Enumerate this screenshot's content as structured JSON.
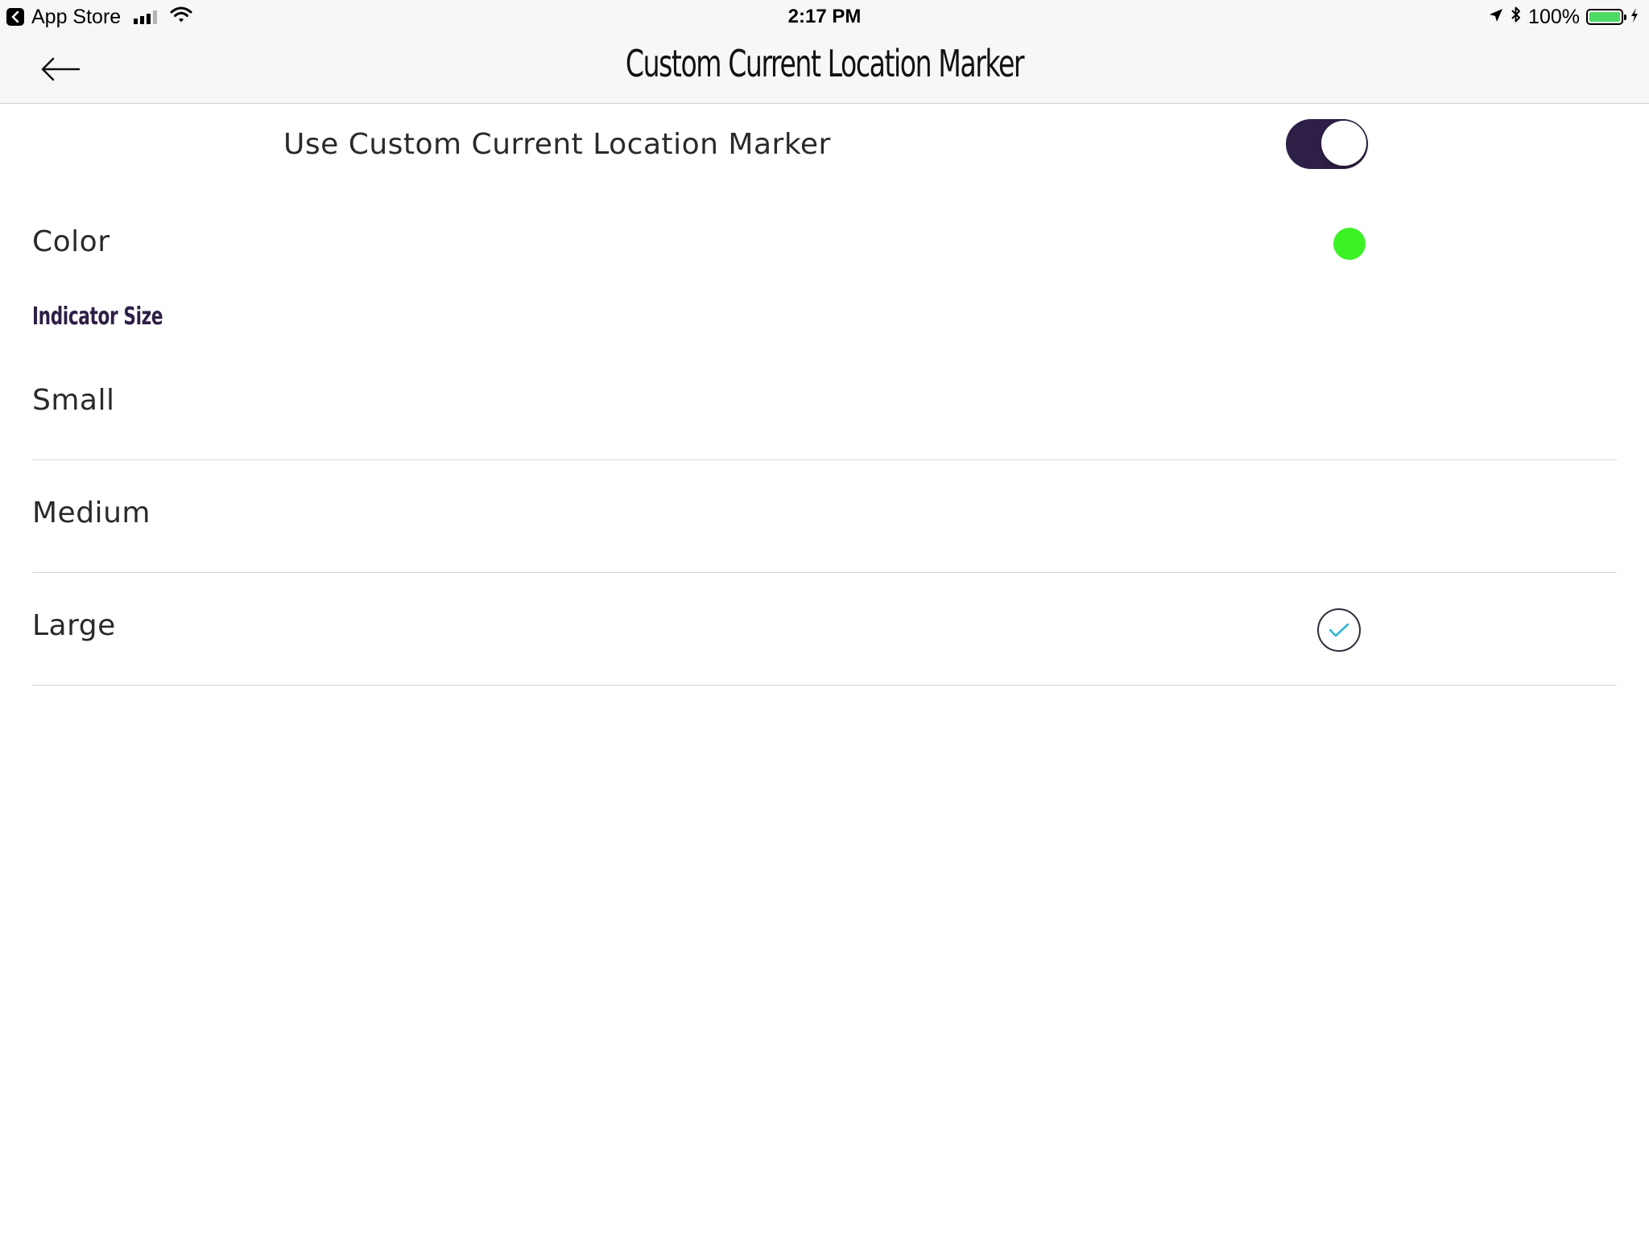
{
  "status_bar": {
    "back_app": "App Store",
    "time": "2:17 PM",
    "battery_percent": "100%",
    "battery_level": 1.0
  },
  "nav": {
    "title": "Custom Current Location Marker"
  },
  "settings": {
    "custom_marker_label": "Use Custom Current Location Marker",
    "custom_marker_enabled": true,
    "color_label": "Color",
    "color_value": "#3cf227",
    "section_title": "Indicator Size",
    "options": [
      {
        "label": "Small",
        "selected": false
      },
      {
        "label": "Medium",
        "selected": false
      },
      {
        "label": "Large",
        "selected": true
      }
    ]
  },
  "colors": {
    "accent_dark": "#2e1f46",
    "check": "#2fb6d8",
    "battery_fill": "#4cd964"
  }
}
